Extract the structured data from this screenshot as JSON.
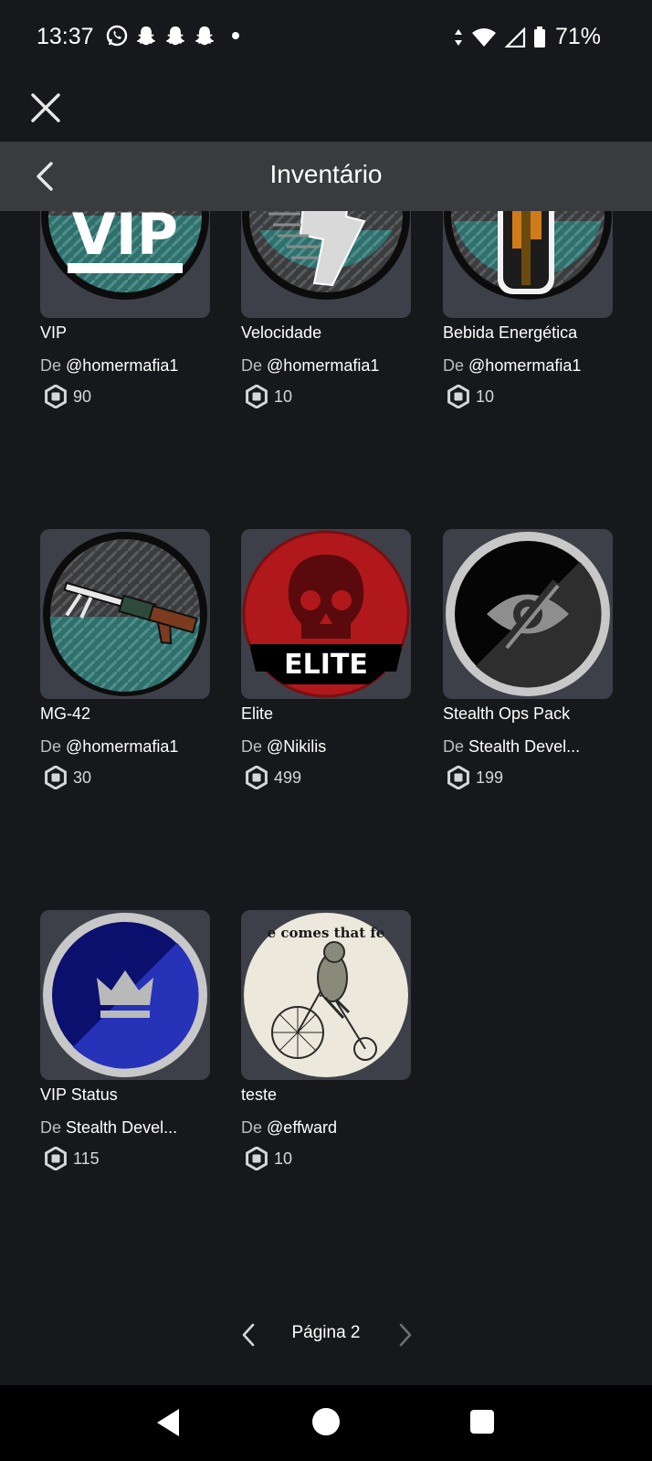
{
  "status_bar": {
    "time": "13:37",
    "battery": "71%",
    "left_icons": [
      "whatsapp-icon",
      "snapchat-icon",
      "snapchat-icon",
      "snapchat-icon",
      "dot"
    ],
    "right_icons": [
      "data-arrows-icon",
      "wifi-icon",
      "signal-icon",
      "battery-icon"
    ]
  },
  "header": {
    "title": "Inventário",
    "close_icon": "close-icon",
    "back_icon": "chevron-left-icon"
  },
  "creator_prefix": "De",
  "items": [
    {
      "name": "VIP",
      "creator": "@homermafia1",
      "price": "90",
      "thumb": "vip-badge"
    },
    {
      "name": "Velocidade",
      "creator": "@homermafia1",
      "price": "10",
      "thumb": "speed-badge"
    },
    {
      "name": "Bebida Energética",
      "creator": "@homermafia1",
      "price": "10",
      "thumb": "energy-drink-badge"
    },
    {
      "name": "MG-42",
      "creator": "@homermafia1",
      "price": "30",
      "thumb": "machine-gun-badge"
    },
    {
      "name": "Elite",
      "creator": "@Nikilis",
      "price": "499",
      "thumb": "elite-skull-badge"
    },
    {
      "name": "Stealth Ops Pack",
      "creator": "Stealth Devel...",
      "price": "199",
      "thumb": "stealth-eye-badge"
    },
    {
      "name": "VIP Status",
      "creator": "Stealth Devel...",
      "price": "115",
      "thumb": "vip-crown-badge"
    },
    {
      "name": "teste",
      "creator": "@effward",
      "price": "10",
      "thumb": "frog-bicycle-image"
    }
  ],
  "thumb_text": {
    "vip": "VIP",
    "elite": "ELITE",
    "frog_caption": "e comes that fe"
  },
  "pagination": {
    "label": "Página 2"
  },
  "colors": {
    "background": "#17181b",
    "header": "#393b3d",
    "tile": "#3e4049",
    "teal_plate": "#2f6f6c",
    "elite_red": "#b0181c"
  }
}
